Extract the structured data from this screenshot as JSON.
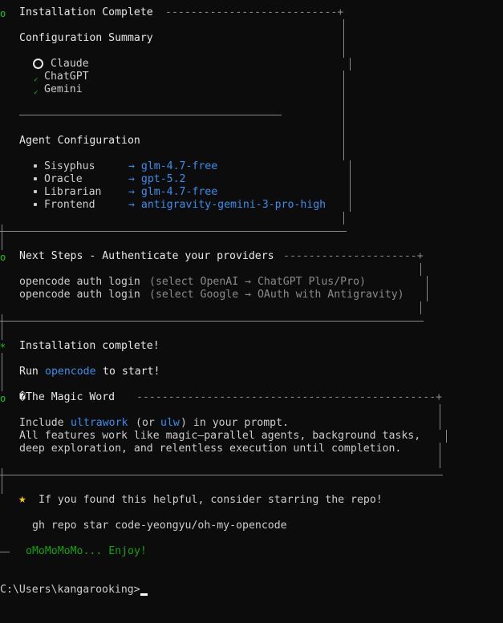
{
  "header1": {
    "title": "Installation Complete",
    "dashes": "---------------------------+"
  },
  "config": {
    "summary_title": "Configuration Summary",
    "providers": [
      {
        "name": "Claude"
      },
      {
        "name": "ChatGPT"
      },
      {
        "name": "Gemini"
      }
    ]
  },
  "agents": {
    "title": "Agent Configuration",
    "items": [
      {
        "name": "Sisyphus",
        "model": "→ glm-4.7-free"
      },
      {
        "name": "Oracle",
        "model": "→ gpt-5.2"
      },
      {
        "name": "Librarian",
        "model": "→ glm-4.7-free"
      },
      {
        "name": "Frontend",
        "model": "→ antigravity-gemini-3-pro-high"
      }
    ]
  },
  "next_steps": {
    "title": "Next Steps - Authenticate your providers",
    "dashes": "---------------------+",
    "commands": [
      {
        "cmd": "opencode auth login",
        "hint": "(select OpenAI → ChatGPT Plus/Pro)"
      },
      {
        "cmd": "opencode auth login",
        "hint": "(select Google → OAuth with Antigravity)"
      }
    ]
  },
  "completion": {
    "title": "Installation complete!",
    "run_prefix": "Run",
    "run_cmd": "opencode",
    "run_suffix": "to start!"
  },
  "magic": {
    "title": "�The Magic Word",
    "dashes": "-----------------------------------------------+",
    "line1_prefix": "Include",
    "line1_word1": "ultrawork",
    "line1_mid": "(or",
    "line1_word2": "ulw",
    "line1_suffix": ") in your prompt.",
    "line2": "All features work like magic—parallel agents, background tasks,",
    "line3": "deep exploration, and relentless execution until completion."
  },
  "footer": {
    "star_text": "If you found this helpful, consider starring the repo!",
    "repo_cmd": "gh repo star code-yeongyu/oh-my-opencode",
    "enjoy": "oMoMoMoMo... Enjoy!"
  },
  "prompt": {
    "text": "C:\\Users\\kangarooking>"
  },
  "colors": {
    "background": "#0c0c0c",
    "text": "#cccccc",
    "link_blue": "#3b8eea",
    "success_green": "#16c60c",
    "star_yellow": "#f1c40f"
  }
}
